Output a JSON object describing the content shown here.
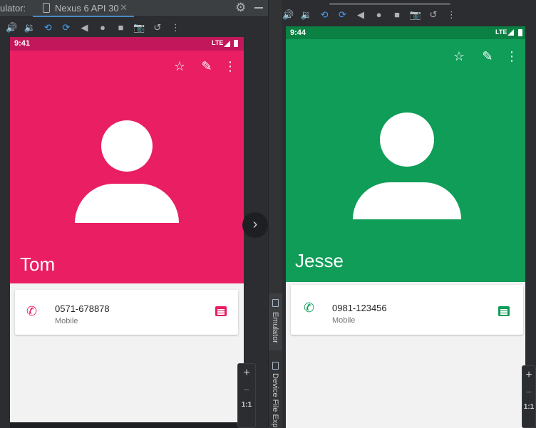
{
  "ide": {
    "tab_prefix": "ulator:",
    "active_tab_label": "Nexus 6 API 30",
    "tab_close": "✕",
    "gear": "⚙",
    "next_button": "›",
    "zoom": {
      "plus": "+",
      "minus": "−",
      "ratio": "1:1"
    }
  },
  "toolbar_icons": [
    {
      "name": "volume-up-icon",
      "glyph": "🔊"
    },
    {
      "name": "volume-down-icon",
      "glyph": "🔉"
    },
    {
      "name": "rotate-left-icon",
      "glyph": "⟲"
    },
    {
      "name": "rotate-right-icon",
      "glyph": "⟳"
    },
    {
      "name": "back-icon",
      "glyph": "◀"
    },
    {
      "name": "home-icon",
      "glyph": "●"
    },
    {
      "name": "overview-icon",
      "glyph": "■"
    },
    {
      "name": "camera-icon",
      "glyph": "📷"
    },
    {
      "name": "snapshot-icon",
      "glyph": "↺"
    },
    {
      "name": "more-icon",
      "glyph": "⋮"
    }
  ],
  "side_tabs": {
    "emulator": "Emulator",
    "device_file_explorer": "Device File Expl"
  },
  "left_phone": {
    "accent_color": "#e91e63",
    "status_bar_color": "#c2185b",
    "status_time": "9:41",
    "status_network": "LTE",
    "contact_name": "Tom",
    "phone_number": "0571-678878",
    "phone_type": "Mobile"
  },
  "right_phone": {
    "accent_color": "#0f9d58",
    "status_bar_color": "#0b8043",
    "status_time": "9:44",
    "status_network": "LTE",
    "contact_name": "Jesse",
    "phone_number": "0981-123456",
    "phone_type": "Mobile"
  },
  "header_icons": {
    "star": "☆",
    "edit": "✎",
    "more": "⋮",
    "phone": "✆"
  }
}
